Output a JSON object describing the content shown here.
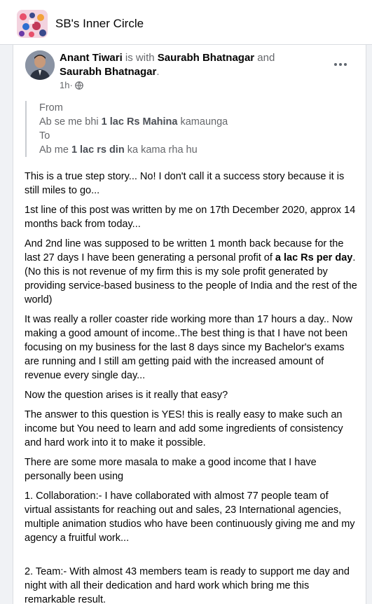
{
  "group": {
    "name": "SB's Inner Circle",
    "icon": "group-collage-icon"
  },
  "post": {
    "author": "Anant Tiwari",
    "with_text": " is with ",
    "tagged_1": "Saurabh Bhatnagar",
    "and_text": " and ",
    "tagged_2": "Saurabh Bhatnagar",
    "end_text": ".",
    "time": "1h",
    "dot": " · ",
    "audience_icon": "globe-icon",
    "menu_icon": "more-options-icon",
    "quote": {
      "l1": "From",
      "l2_a": "Ab se me bhi ",
      "l2_b": "1 lac Rs Mahina",
      "l2_c": " kamaunga",
      "l3": "To",
      "l4_a": "Ab me ",
      "l4_b": "1 lac rs din",
      "l4_c": " ka kama rha hu"
    },
    "p1": "This is a true step story... No! I don't call it a success story because it is still miles to go...",
    "p2": "1st line of this post was written by me on 17th December 2020, approx 14 months back from today...",
    "p3_a": "And 2nd line was supposed to be written 1 month back because for the last 27 days I have been generating a personal profit of ",
    "p3_b": "a lac Rs per day",
    "p3_c": ". (No this is not revenue of my firm this is my sole profit generated by providing service-based business to the people of India and the rest of the world)",
    "p4": "It was really a roller coaster ride working more than 17 hours a day.. Now making a good amount of income..The best thing is that I have not been focusing on my business for the last 8 days since my Bachelor's exams are running and I still am getting paid with the increased amount of revenue every single day...",
    "p5": "Now the question arises is it really that easy?",
    "p6": "The answer to this question is YES! this is really easy to make such an income but You need to learn and add some ingredients of consistency and hard work into it to make it possible.",
    "p7": "There are some more masala to make a good income that I have personally been using",
    "p8": "1. Collaboration:- I have collaborated with almost 77 people team of virtual assistants for reaching out and sales, 23 International agencies, multiple animation studios who have been continuously giving me and my agency a fruitful work...",
    "p9": "2. Team:- With almost 43 members team is ready to support me day and night with all their dedication and hard work which bring me this remarkable result."
  }
}
